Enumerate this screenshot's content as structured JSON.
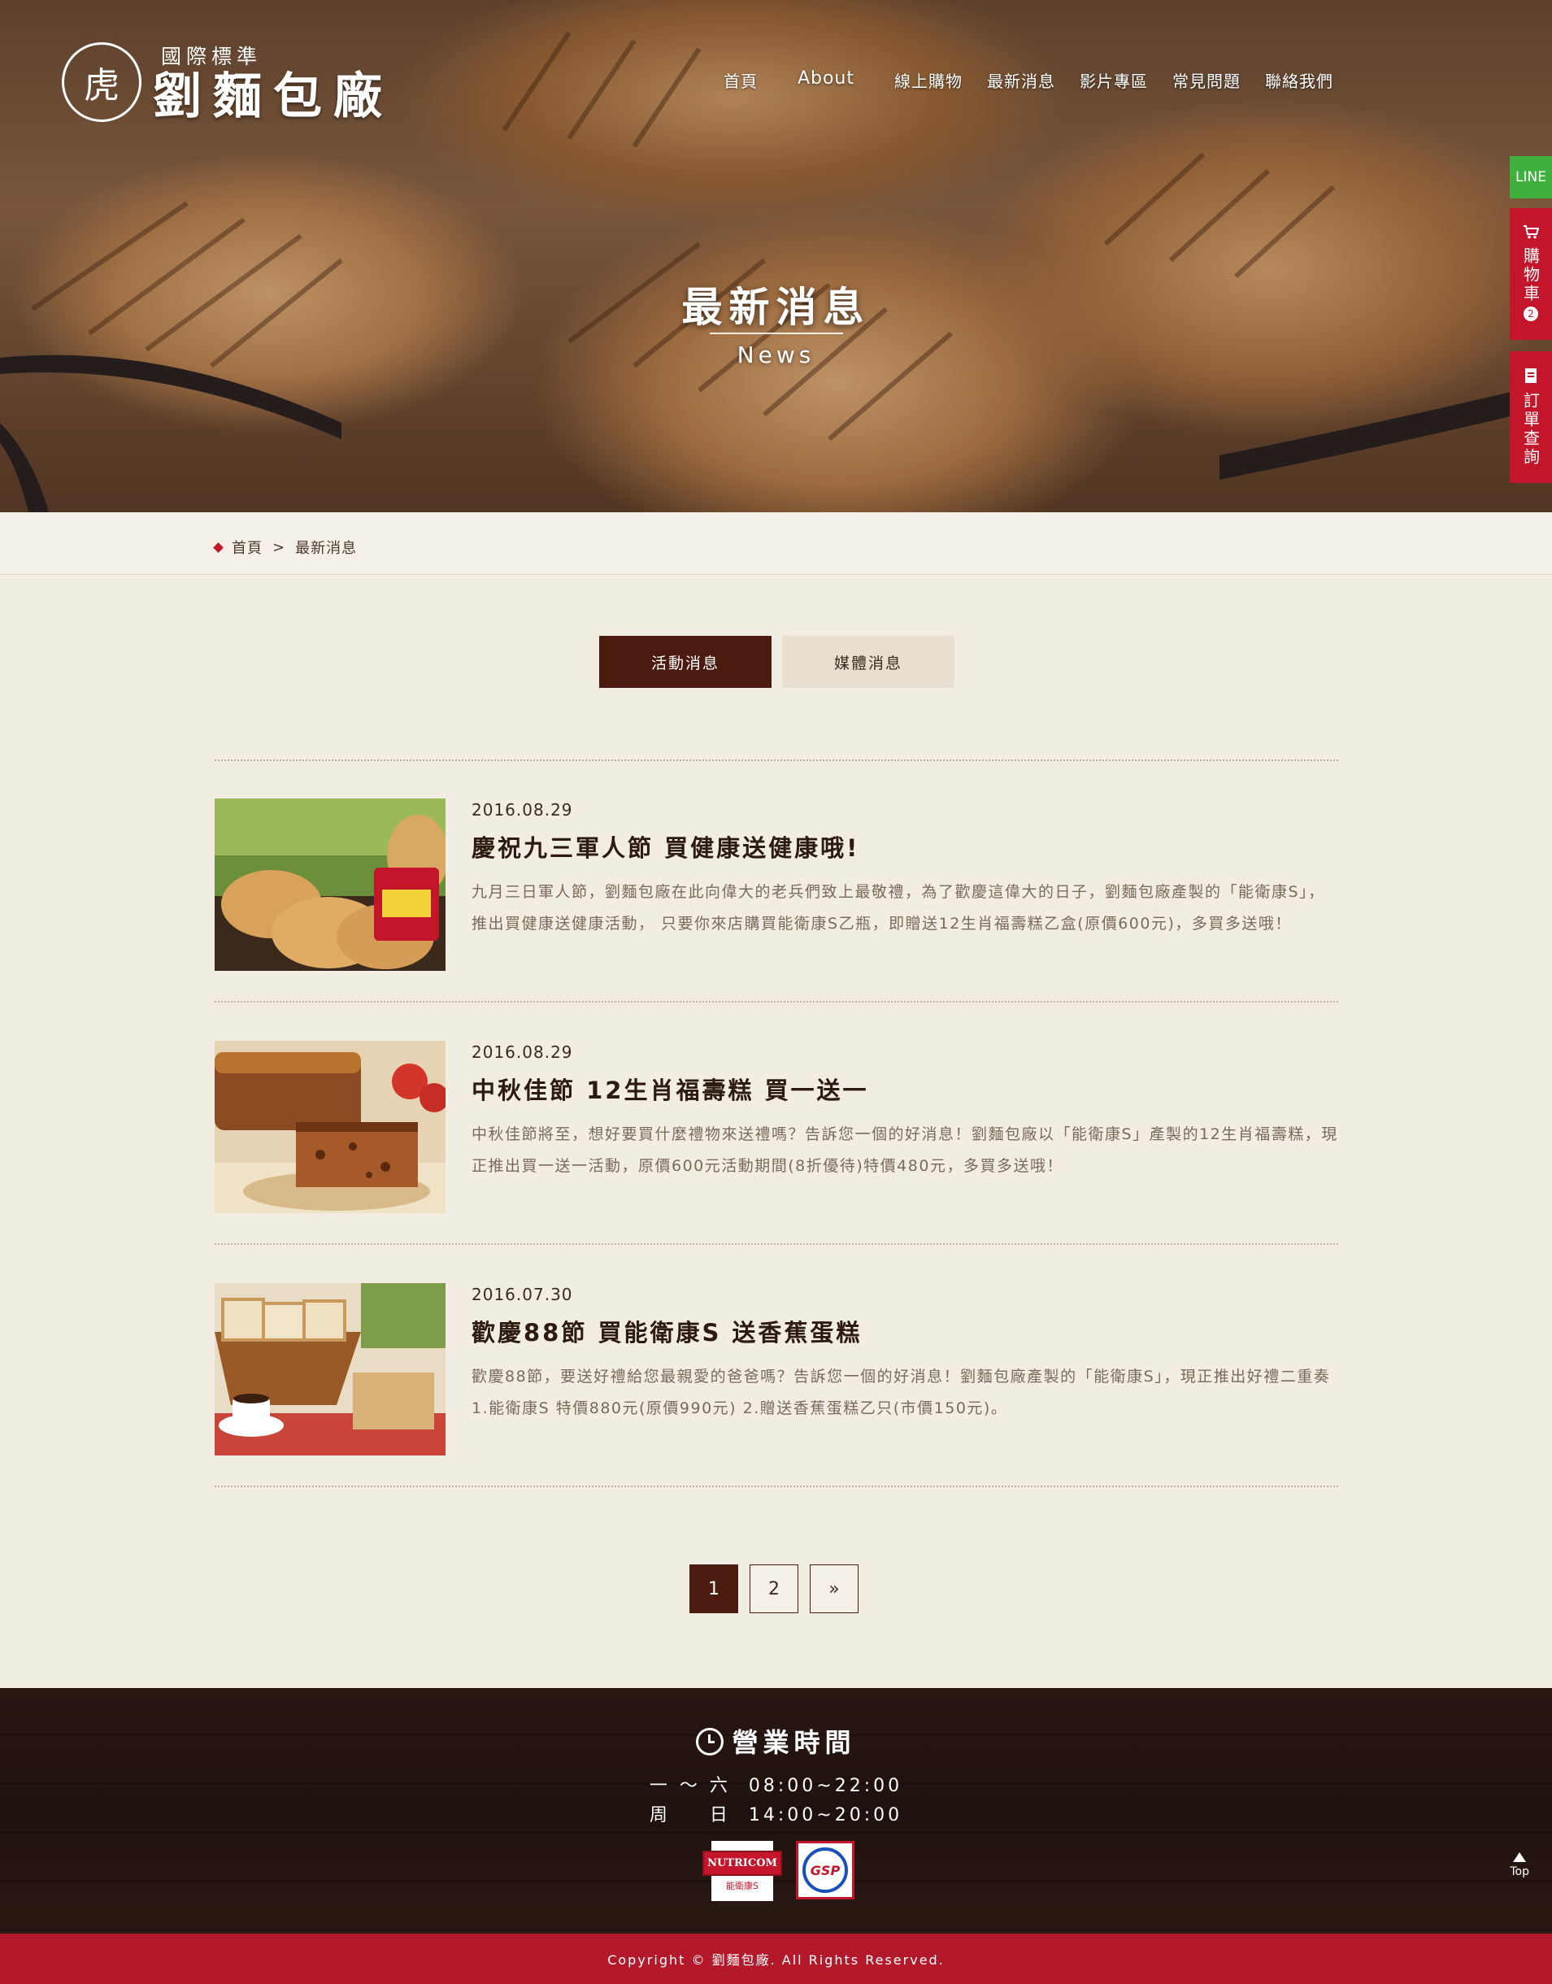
{
  "brand": {
    "logo_mark": "虎",
    "tagline": "國際標準",
    "name": "劉麵包廠"
  },
  "nav": {
    "items": [
      "首頁",
      "About",
      "線上購物",
      "最新消息",
      "影片專區",
      "常見問題",
      "聯絡我們"
    ]
  },
  "hero": {
    "title": "最新消息",
    "subtitle": "News"
  },
  "side_tabs": {
    "line": "LINE",
    "cart": "購物車",
    "cart_count": "2",
    "order": "訂單查詢"
  },
  "breadcrumb": {
    "home": "首頁",
    "sep": ">",
    "current": "最新消息"
  },
  "tabs": {
    "active": "活動消息",
    "inactive": "媒體消息"
  },
  "news": [
    {
      "date": "2016.08.29",
      "title": "慶祝九三軍人節 買健康送健康哦!",
      "desc": "九月三日軍人節，劉麵包廠在此向偉大的老兵們致上最敬禮，為了歡慶這偉大的日子，劉麵包廠產製的「能衛康S」，推出買健康送健康活動， 只要你來店購買能衛康S乙瓶，即贈送12生肖福壽糕乙盒(原價600元)，多買多送哦！"
    },
    {
      "date": "2016.08.29",
      "title": "中秋佳節 12生肖福壽糕 買一送一",
      "desc": "中秋佳節將至，想好要買什麼禮物來送禮嗎？告訴您一個的好消息！劉麵包廠以「能衛康S」產製的12生肖福壽糕，現正推出買一送一活動，原價600元活動期間(8折優待)特價480元，多買多送哦！"
    },
    {
      "date": "2016.07.30",
      "title": "歡慶88節 買能衛康S 送香蕉蛋糕",
      "desc": "歡慶88節，要送好禮給您最親愛的爸爸嗎？告訴您一個的好消息！劉麵包廠產製的「能衛康S」，現正推出好禮二重奏 1.能衛康S 特價880元(原價990元) 2.贈送香蕉蛋糕乙只(市價150元)。"
    }
  ],
  "pagination": {
    "pages": [
      "1",
      "2"
    ],
    "next": "»",
    "current": "1"
  },
  "footer": {
    "hours_title": "營業時間",
    "hours": [
      {
        "days": "一 ～ 六",
        "time": "08:00~22:00"
      },
      {
        "days": "周 　 日",
        "time": "14:00~20:00"
      }
    ],
    "badge_nutricom": "NUTRICOM",
    "badge_nutricom_caption": "能衛康S",
    "badge_gsp": "GSP",
    "top": "Top",
    "copyright": "Copyright © 劉麵包廠. All Rights Reserved."
  },
  "colors": {
    "brand_dark": "#4a1b0e",
    "accent_red": "#c4162a",
    "line_green": "#3db13b",
    "background": "#f2ede3"
  }
}
